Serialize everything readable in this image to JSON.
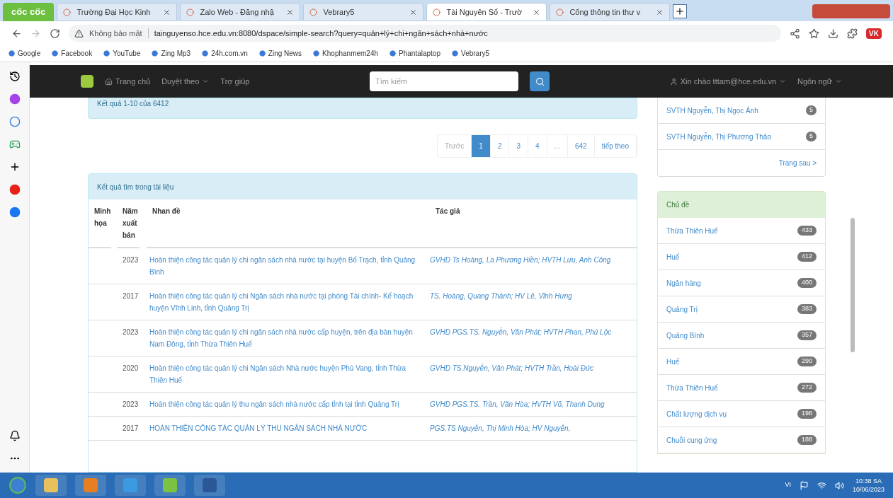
{
  "browser": {
    "logo": "cốc cốc",
    "tabs": [
      {
        "label": "Trường Đại Học Kinh",
        "selected": false
      },
      {
        "label": "Zalo Web - Đăng nhậ",
        "selected": false
      },
      {
        "label": "Vebrary5",
        "selected": false
      },
      {
        "label": "Tài Nguyên Số - Trườ",
        "selected": true
      },
      {
        "label": "Cổng thông tin thư v",
        "selected": false
      }
    ],
    "security": "Không bảo mật",
    "address": "tainguyenso.hce.edu.vn:8080/dspace/simple-search?query=quản+lý+chi+ngân+sách+nhà+nước",
    "extension_label": "VK",
    "bookmarks": [
      "Google",
      "Facebook",
      "YouTube",
      "Zing Mp3",
      "24h.com.vn",
      "Zing News",
      "Khophanmem24h",
      "Phantalaptop",
      "Vebrary5"
    ]
  },
  "navbar": {
    "links": [
      {
        "label": "Trang chủ",
        "dropdown": false
      },
      {
        "label": "Duyệt theo",
        "dropdown": true
      },
      {
        "label": "Trợ giúp",
        "dropdown": false
      }
    ],
    "search": {
      "placeholder": "Tìm kiếm"
    },
    "user": "Xin chào tttam@hce.edu.vn",
    "language": "Ngôn ngữ"
  },
  "results_summary": "Kết quả 1-10 của 6412",
  "pagination": [
    {
      "label": "Trước",
      "selected": false,
      "disabled": true
    },
    {
      "label": "1",
      "selected": true,
      "disabled": false
    },
    {
      "label": "2",
      "selected": false,
      "disabled": false
    },
    {
      "label": "3",
      "selected": false,
      "disabled": false
    },
    {
      "label": "4",
      "selected": false,
      "disabled": false
    },
    {
      "label": "...",
      "selected": false,
      "disabled": true
    },
    {
      "label": "642",
      "selected": false,
      "disabled": false
    },
    {
      "label": "tiếp theo",
      "selected": false,
      "disabled": false
    }
  ],
  "results": {
    "title": "Kết quả tìm trong tài liệu",
    "columns": [
      "Minh họa",
      "Năm xuất bản",
      "Nhan đề",
      "Tác giả"
    ],
    "rows": [
      {
        "year": "2023",
        "title": "Hoàn thiện công tác quản lý chi ngân sách nhà nước tại huyện Bố Trạch, tỉnh Quảng Bình",
        "author": "GVHD Ts Hoàng, La Phương Hiền; HVTH Lưu, Anh Công"
      },
      {
        "year": "2017",
        "title": "Hoàn thiện công tác quản lý chi Ngân sách nhà nước tại phòng Tài chính- Kế hoạch huyện Vĩnh Linh, tỉnh Quảng Trị",
        "author": "TS. Hoàng, Quang Thành; HV Lê, Vĩnh Hưng"
      },
      {
        "year": "2023",
        "title": "Hoàn thiện công tác quản lý chi ngân sách nhà nước cấp huyện, trên địa bàn huyện Nam Đông, tỉnh Thừa Thiên Huế",
        "author": "GVHD PGS.TS. Nguyễn, Văn Phát; HVTH Phan, Phú Lộc"
      },
      {
        "year": "2020",
        "title": "Hoàn thiện công tác quản lý chi Ngân sách Nhà nước huyện Phú Vang, tỉnh Thừa Thiên Huế",
        "author": "GVHD TS.Nguyễn, Văn Phát; HVTH Trần, Hoài Đức"
      },
      {
        "year": "2023",
        "title": "Hoàn thiện công tác quản lý thu ngân sách nhà nước cấp tỉnh tại tỉnh Quảng Trị",
        "author": "GVHD PGS.TS. Trần, Văn Hòa; HVTH Võ, Thanh Dung"
      },
      {
        "year": "2017",
        "title": "HOÀN THIỆN CÔNG TÁC QUẢN LÝ THU NGÂN SÁCH NHÀ NƯỚC",
        "author": "PGS.TS Nguyễn, Thị Minh Hòa; HV Nguyễn,"
      }
    ]
  },
  "authors_facet": {
    "items": [
      {
        "label": "SVTH Nguyễn, Thị Ngọc Ánh",
        "count": "5"
      },
      {
        "label": "SVTH Nguyễn, Thị Phương Thảo",
        "count": "5"
      }
    ],
    "next": "Trang sau >"
  },
  "subject_facet": {
    "title": "Chủ đề",
    "items": [
      {
        "label": "Thừa Thiên Huế",
        "count": "433"
      },
      {
        "label": "Huế",
        "count": "412"
      },
      {
        "label": "Ngân hàng",
        "count": "400"
      },
      {
        "label": "Quảng Trị",
        "count": "383"
      },
      {
        "label": "Quảng Bình",
        "count": "357"
      },
      {
        "label": "Huế",
        "count": "290"
      },
      {
        "label": "Thừa Thiên Huế",
        "count": "272"
      },
      {
        "label": "Chất lượng dịch vụ",
        "count": "198"
      },
      {
        "label": "Chuỗi cung ứng",
        "count": "188"
      }
    ]
  },
  "taskbar": {
    "time": "10:38 SA",
    "date": "10/06/2023",
    "language": "VI"
  }
}
